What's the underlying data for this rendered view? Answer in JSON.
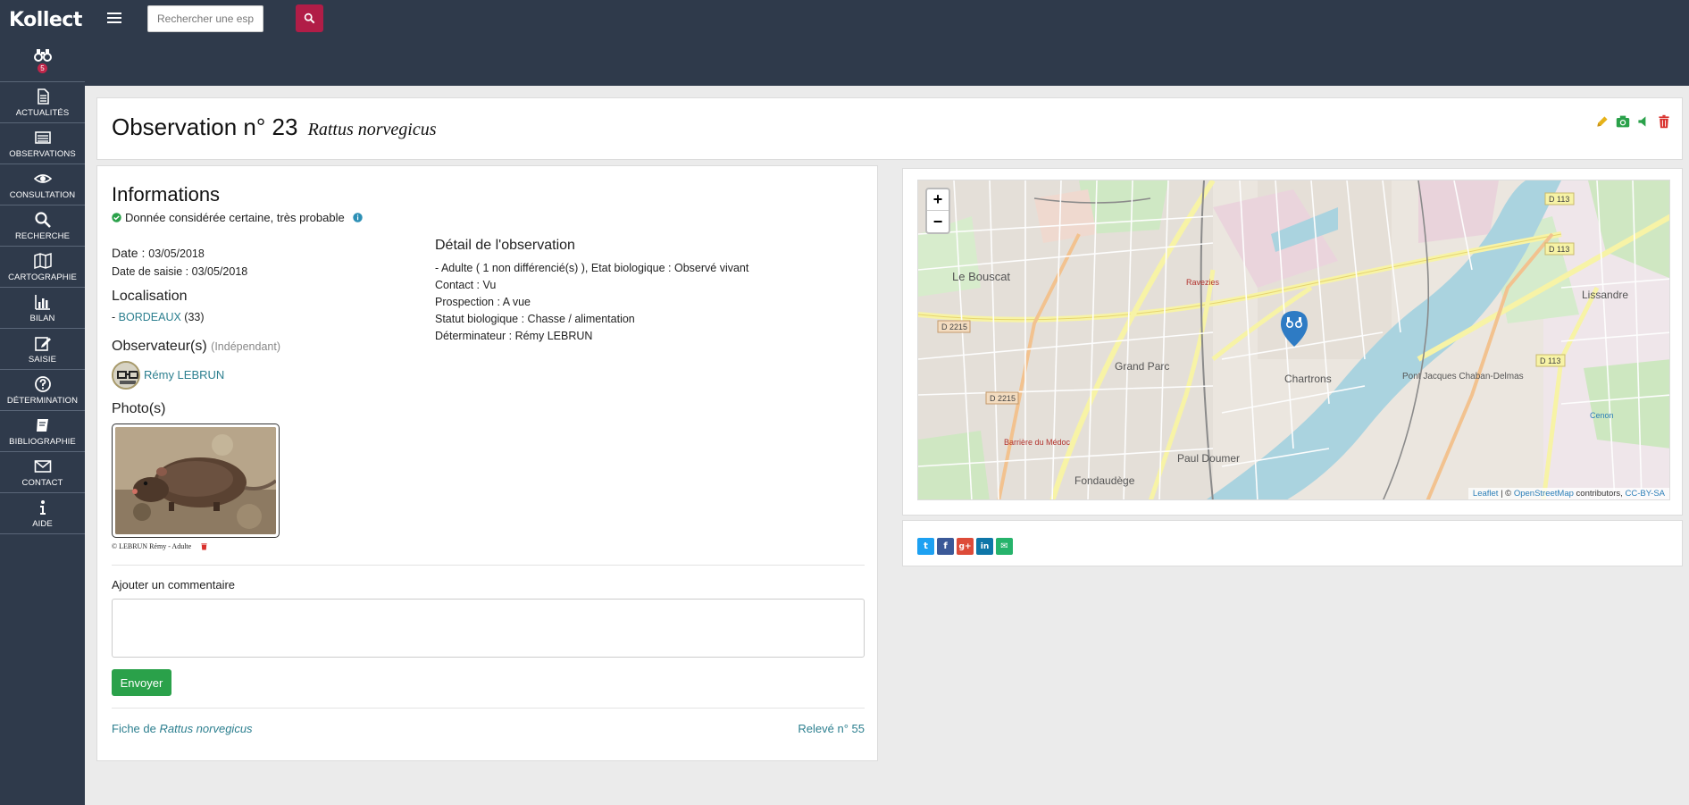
{
  "app": {
    "brand": "Kollect"
  },
  "sidebar": {
    "badge": "5",
    "items": [
      {
        "label": "ACTUALITÉS",
        "icon": "document-icon"
      },
      {
        "label": "OBSERVATIONS",
        "icon": "list-icon"
      },
      {
        "label": "CONSULTATION",
        "icon": "eye-icon"
      },
      {
        "label": "RECHERCHE",
        "icon": "search-icon"
      },
      {
        "label": "CARTOGRAPHIE",
        "icon": "map-icon"
      },
      {
        "label": "BILAN",
        "icon": "bar-chart-icon"
      },
      {
        "label": "SAISIE",
        "icon": "edit-icon"
      },
      {
        "label": "DÉTERMINATION",
        "icon": "question-icon"
      },
      {
        "label": "BIBLIOGRAPHIE",
        "icon": "book-icon"
      },
      {
        "label": "CONTACT",
        "icon": "envelope-icon"
      },
      {
        "label": "AIDE",
        "icon": "info-icon"
      }
    ]
  },
  "topbar": {
    "search_placeholder": "Rechercher une espèce"
  },
  "observation": {
    "title": "Observation n° 23",
    "species": "Rattus norvegicus"
  },
  "info": {
    "heading": "Informations",
    "certainty": "Donnée considérée certaine, très probable",
    "date_label": "Date :",
    "date_value": "03/05/2018",
    "entry_date_label": "Date de saisie :",
    "entry_date_value": "03/05/2018",
    "location_heading": "Localisation",
    "location_prefix": "-",
    "location_city": "BORDEAUX",
    "location_dept": "(33)",
    "observers_heading": "Observateur(s)",
    "observers_note": "(Indépendant)",
    "observer_name": "Rémy LEBRUN",
    "photos_heading": "Photo(s)",
    "photo_caption": "© LEBRUN Rémy - Adulte"
  },
  "detail": {
    "heading": "Détail de l'observation",
    "lines": [
      "- Adulte ( 1 non différencié(s) ), Etat biologique : Observé vivant",
      "Contact : Vu",
      "Prospection : A vue",
      "Statut biologique : Chasse / alimentation",
      "Déterminateur : Rémy LEBRUN"
    ]
  },
  "comment": {
    "label": "Ajouter un commentaire",
    "send_label": "Envoyer"
  },
  "footer": {
    "species_link_prefix": "Fiche de",
    "species_link_name": "Rattus norvegicus",
    "releve_link": "Relevé n° 55"
  },
  "map": {
    "zoom_in": "+",
    "zoom_out": "−",
    "attribution_leaflet": "Leaflet",
    "attribution_sep": " | © ",
    "attribution_osm": "OpenStreetMap",
    "attribution_contrib": " contributors, ",
    "attribution_license": "CC-BY-SA",
    "labels": {
      "le_bouscat": "Le Bouscat",
      "grand_parc": "Grand Parc",
      "chartrons": "Chartrons",
      "paul_doumer": "Paul Doumer",
      "fondaudege": "Fondaudège",
      "lissandre": "Lissandre",
      "pont_jacques": "Pont Jacques Chaban-Delmas",
      "d2215_a": "D 2215",
      "d2215_b": "D 2215",
      "d113_a": "D 113",
      "d113_b": "D 113",
      "d113_c": "D 113",
      "barriere_medoc": "Barrière du Médoc",
      "ravezies": "Ravezies",
      "cenon": "Cenon"
    }
  },
  "share": {
    "twitter": "t",
    "facebook": "f",
    "google": "g+",
    "linkedin": "in",
    "email": "✉"
  },
  "colors": {
    "sidebar_bg": "#2f3a4b",
    "accent": "#b11d47",
    "send_green": "#2aa14a",
    "link": "#2c7f8f"
  }
}
